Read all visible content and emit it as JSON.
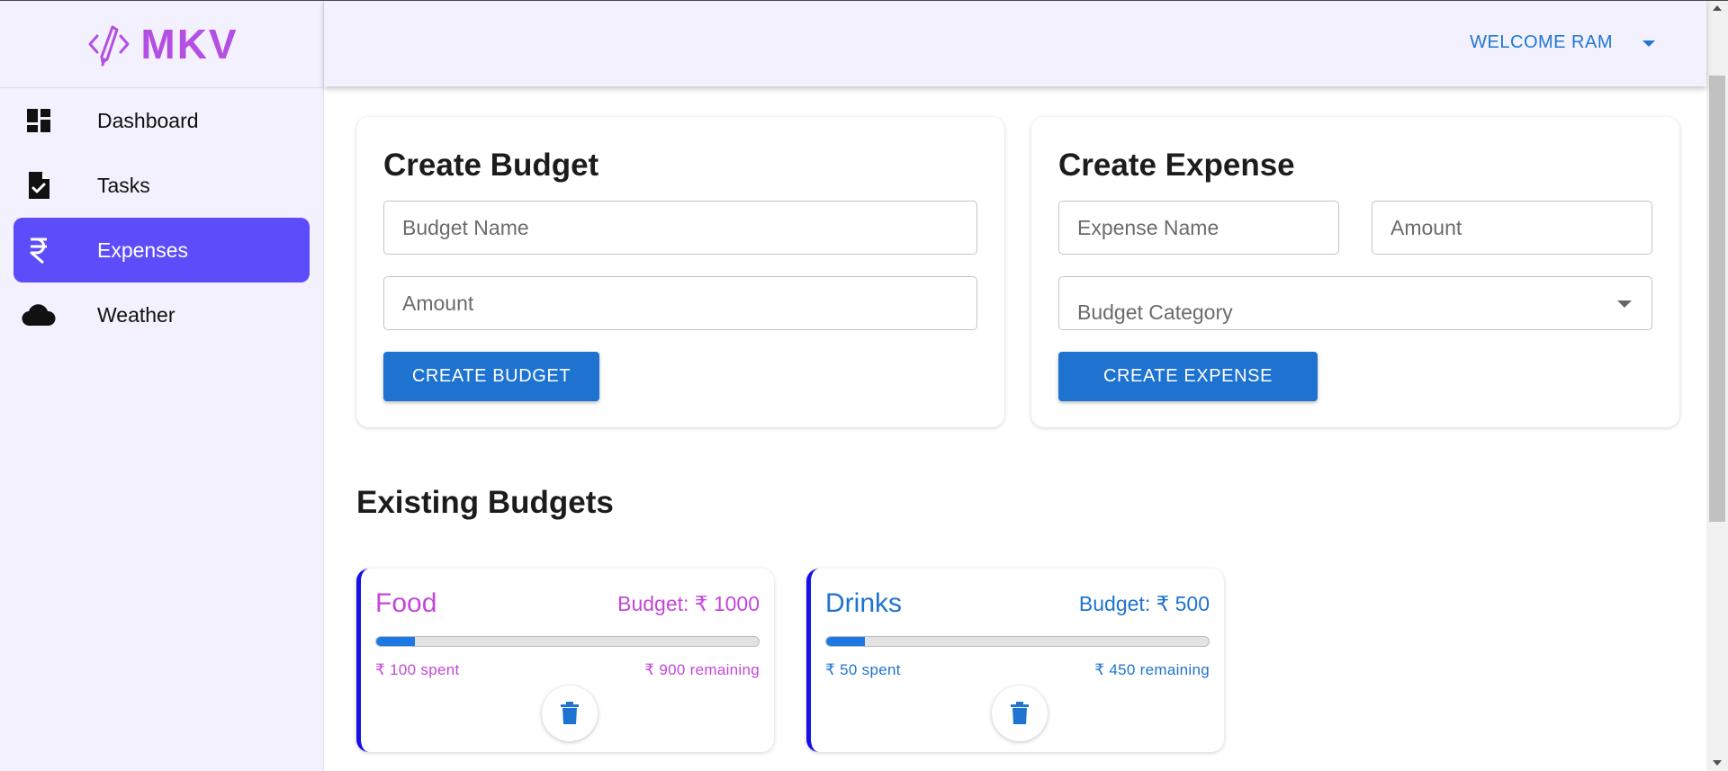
{
  "brand": {
    "name": "MKV",
    "color": "#b44fe3"
  },
  "header": {
    "welcome": "WELCOME RAM"
  },
  "sidebar": {
    "items": [
      {
        "label": "Dashboard",
        "icon": "dashboard-icon",
        "active": false
      },
      {
        "label": "Tasks",
        "icon": "task-file-icon",
        "active": false
      },
      {
        "label": "Expenses",
        "icon": "rupee-icon",
        "active": true
      },
      {
        "label": "Weather",
        "icon": "cloud-icon",
        "active": false
      }
    ],
    "active_color": "#5d4cf9"
  },
  "create_budget": {
    "title": "Create Budget",
    "name_placeholder": "Budget Name",
    "amount_placeholder": "Amount",
    "button": "CREATE BUDGET"
  },
  "create_expense": {
    "title": "Create Expense",
    "name_placeholder": "Expense Name",
    "amount_placeholder": "Amount",
    "category_label": "Budget Category",
    "button": "CREATE EXPENSE"
  },
  "existing_budgets": {
    "title": "Existing Budgets",
    "items": [
      {
        "name": "Food",
        "budget": "Budget: ₹ 1000",
        "spent": "₹ 100 spent",
        "remaining": "₹ 900 remaining",
        "progress": 0.1,
        "color": "#c447d9"
      },
      {
        "name": "Drinks",
        "budget": "Budget: ₹ 500",
        "spent": "₹ 50 spent",
        "remaining": "₹ 450 remaining",
        "progress": 0.1,
        "color": "#1f73d0"
      }
    ]
  },
  "colors": {
    "primary_button": "#1f73d0",
    "accent_border": "#1510e6",
    "header_text": "#1f77d4"
  }
}
